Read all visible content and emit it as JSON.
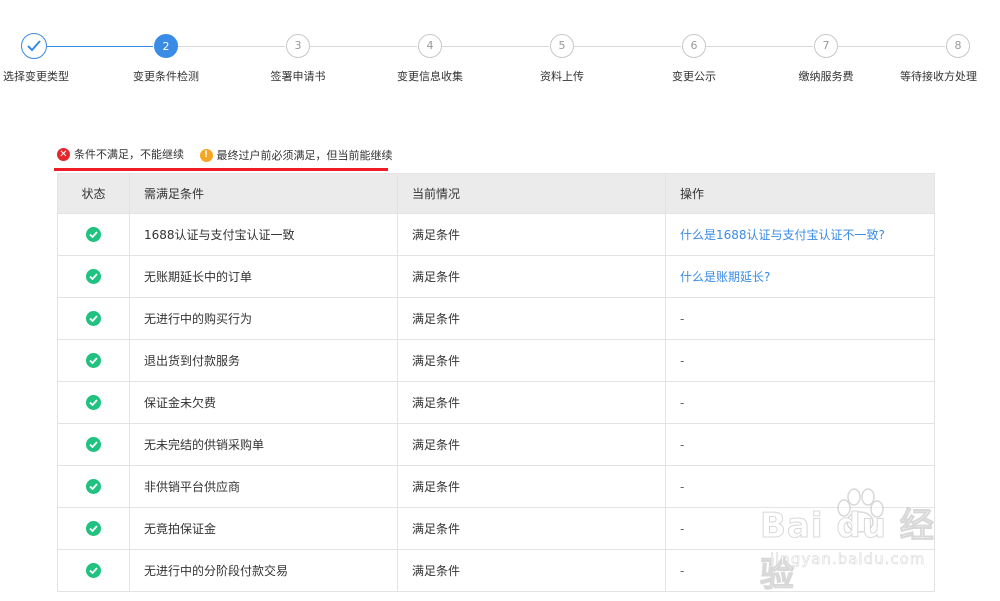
{
  "stepper": {
    "steps": [
      {
        "label": "选择变更类型",
        "number": "",
        "state": "done"
      },
      {
        "label": "变更条件检测",
        "number": "2",
        "state": "active"
      },
      {
        "label": "签署申请书",
        "number": "3",
        "state": "pending"
      },
      {
        "label": "变更信息收集",
        "number": "4",
        "state": "pending"
      },
      {
        "label": "资料上传",
        "number": "5",
        "state": "pending"
      },
      {
        "label": "变更公示",
        "number": "6",
        "state": "pending"
      },
      {
        "label": "缴纳服务费",
        "number": "7",
        "state": "pending"
      },
      {
        "label": "等待接收方处理",
        "number": "8",
        "state": "pending"
      }
    ],
    "active_color": "#3a8be6"
  },
  "legend": {
    "blocking": {
      "icon": "x-circle-icon",
      "text": "条件不满足，不能继续",
      "color": "#e5262b"
    },
    "warning": {
      "icon": "exclamation-circle-icon",
      "text": "最终过户前必须满足，但当前能继续",
      "color": "#f5a623"
    }
  },
  "table": {
    "headers": {
      "status": "状态",
      "condition": "需满足条件",
      "current": "当前情况",
      "action": "操作"
    },
    "rows": [
      {
        "condition": "1688认证与支付宝认证一致",
        "current": "满足条件",
        "action": "什么是1688认证与支付宝认证不一致?",
        "action_is_link": true
      },
      {
        "condition": "无账期延长中的订单",
        "current": "满足条件",
        "action": "什么是账期延长?",
        "action_is_link": true
      },
      {
        "condition": "无进行中的购买行为",
        "current": "满足条件",
        "action": "-",
        "action_is_link": false
      },
      {
        "condition": "退出货到付款服务",
        "current": "满足条件",
        "action": "-",
        "action_is_link": false
      },
      {
        "condition": "保证金未欠费",
        "current": "满足条件",
        "action": "-",
        "action_is_link": false
      },
      {
        "condition": "无未完结的供销采购单",
        "current": "满足条件",
        "action": "-",
        "action_is_link": false
      },
      {
        "condition": "非供销平台供应商",
        "current": "满足条件",
        "action": "-",
        "action_is_link": false
      },
      {
        "condition": "无竟拍保证金",
        "current": "满足条件",
        "action": "-",
        "action_is_link": false
      },
      {
        "condition": "无进行中的分阶段付款交易",
        "current": "满足条件",
        "action": "-",
        "action_is_link": false
      }
    ],
    "status_color": "#1fc27e",
    "link_color": "#3a8be6"
  },
  "watermark": {
    "logo": "Bai du 经验",
    "sub": "jingyan.baidu.com"
  }
}
